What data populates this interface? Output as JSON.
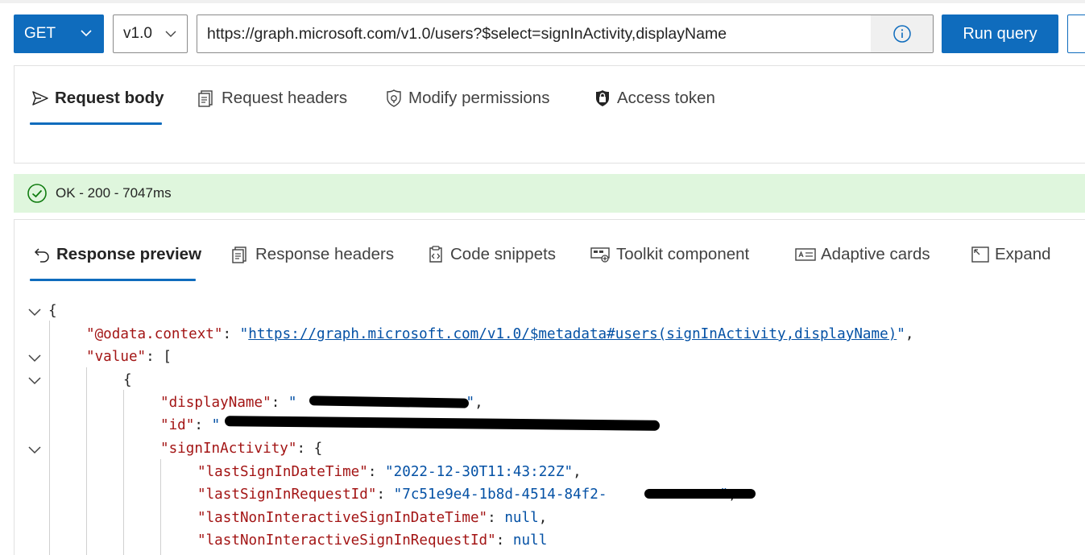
{
  "query_bar": {
    "method": "GET",
    "version": "v1.0",
    "url": "https://graph.microsoft.com/v1.0/users?$select=signInActivity,displayName",
    "info_icon": "info-icon",
    "run_label": "Run query"
  },
  "request_tabs": [
    {
      "label": "Request body",
      "icon": "send-icon"
    },
    {
      "label": "Request headers",
      "icon": "document-icon"
    },
    {
      "label": "Modify permissions",
      "icon": "shield-icon"
    },
    {
      "label": "Access token",
      "icon": "lock-icon"
    }
  ],
  "status": {
    "text": "OK - 200 - 7047ms",
    "icon": "checkmark-circle-icon",
    "color": "#dff6dd"
  },
  "response_tabs": [
    {
      "label": "Response preview",
      "icon": "undo-arrow-icon"
    },
    {
      "label": "Response headers",
      "icon": "document-icon"
    },
    {
      "label": "Code snippets",
      "icon": "code-clipboard-icon"
    },
    {
      "label": "Toolkit component",
      "icon": "toolkit-icon"
    },
    {
      "label": "Adaptive cards",
      "icon": "card-icon"
    },
    {
      "label": "Expand",
      "icon": "expand-icon"
    }
  ],
  "response": {
    "open_brace": "{",
    "context_key": "\"@odata.context\"",
    "context_value": "https://graph.microsoft.com/v1.0/$metadata#users(signInActivity,displayName)",
    "value_key": "\"value\"",
    "display_name_key": "\"displayName\"",
    "id_key": "\"id\"",
    "sign_in_activity_key": "\"signInActivity\"",
    "last_sign_in_key": "\"lastSignInDateTime\"",
    "last_sign_in_value": "\"2022-12-30T11:43:22Z\"",
    "last_request_key": "\"lastSignInRequestId\"",
    "last_request_value": "\"7c51e9e4-1b8d-4514-84f2-",
    "last_nonint_key": "\"lastNonInteractiveSignInDateTime\"",
    "last_nonint_request_key": "\"lastNonInteractiveSignInRequestId\"",
    "null_value": "null"
  },
  "colors": {
    "accent": "#0f6cbd",
    "key": "#a31515",
    "string": "#0451a5"
  }
}
